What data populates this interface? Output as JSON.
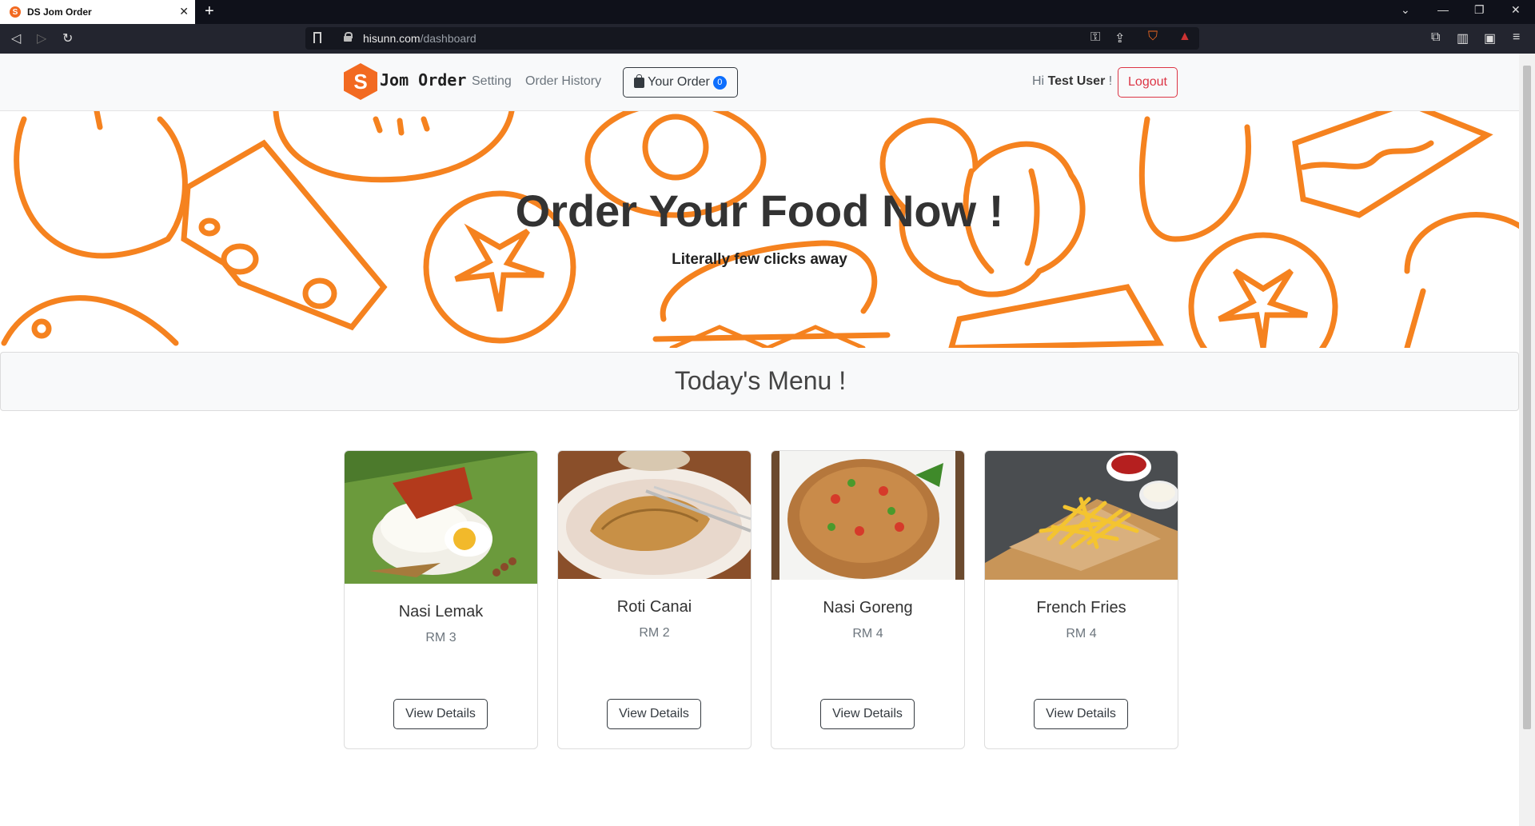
{
  "browser": {
    "tab_title": "DS Jom Order",
    "tab_favicon_letter": "S",
    "url_host": "hisunn.com",
    "url_path": "/dashboard"
  },
  "header": {
    "logo_letter": "S",
    "brand": "Jom Order",
    "nav": [
      "Setting",
      "Order History"
    ],
    "order_button": "Your Order",
    "order_count": "0",
    "greeting_prefix": "Hi",
    "user_name": "Test User",
    "greeting_suffix": "!",
    "logout": "Logout"
  },
  "hero": {
    "title": "Order Your Food Now !",
    "subtitle": "Literally few clicks away"
  },
  "menu": {
    "title": "Today's Menu !",
    "items": [
      {
        "name": "Nasi Lemak",
        "price": "RM 3",
        "button": "View Details"
      },
      {
        "name": "Roti Canai",
        "price": "RM 2",
        "button": "View Details"
      },
      {
        "name": "Nasi Goreng",
        "price": "RM 4",
        "button": "View Details"
      },
      {
        "name": "French Fries",
        "price": "RM 4",
        "button": "View Details"
      }
    ]
  },
  "colors": {
    "brand_orange": "#f26a21",
    "pattern_orange": "#f5821f",
    "logout_red": "#dc3545",
    "badge_blue": "#0d6efd"
  }
}
